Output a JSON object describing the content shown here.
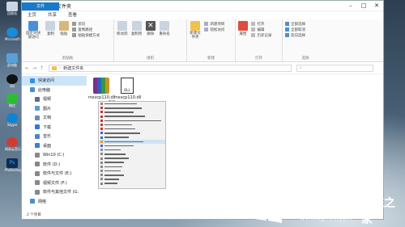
{
  "window": {
    "title": "新建文件夹"
  },
  "tabs": [
    "文件",
    "主页",
    "共享",
    "查看"
  ],
  "ribbon": {
    "clipboard": {
      "label": "剪贴板",
      "pin": "固定到快速访问",
      "copy": "复制",
      "paste": "粘贴",
      "cut": "剪切",
      "copy_path": "复制路径",
      "paste_shortcut": "粘贴快捷方式"
    },
    "organize": {
      "label": "组织",
      "move_to": "移动到",
      "copy_to": "复制到",
      "delete": "删除",
      "rename": "重命名"
    },
    "new": {
      "label": "新建",
      "new_folder": "新建文件夹",
      "new_item": "新建项目",
      "easy_access": "轻松访问"
    },
    "open": {
      "label": "打开",
      "properties": "属性",
      "open": "打开",
      "edit": "编辑",
      "history": "历史记录"
    },
    "select": {
      "label": "选择",
      "select_all": "全部选择",
      "select_none": "全部取消",
      "invert": "反向选择"
    }
  },
  "address": {
    "path": "新建文件夹"
  },
  "nav": {
    "items": [
      {
        "label": "快速访问",
        "color": "#3a8ee6"
      },
      {
        "label": "此电脑",
        "color": "#4a90c8"
      },
      {
        "label": "视频",
        "color": "#5a6e90"
      },
      {
        "label": "图片",
        "color": "#5a9cc8"
      },
      {
        "label": "文档",
        "color": "#6a8eb0"
      },
      {
        "label": "下载",
        "color": "#2f7bd6"
      },
      {
        "label": "音乐",
        "color": "#4a86d0"
      },
      {
        "label": "桌面",
        "color": "#3d7fd1"
      },
      {
        "label": "Win10 (C:)",
        "color": "#888888"
      },
      {
        "label": "软件 (D:)",
        "color": "#888888"
      },
      {
        "label": "软件与文件 (E:)",
        "color": "#888888"
      },
      {
        "label": "视频文件 (F:)",
        "color": "#888888"
      },
      {
        "label": "软件与其他文件 (G:",
        "color": "#888888"
      },
      {
        "label": "网络",
        "color": "#4a90c8"
      }
    ]
  },
  "files": [
    {
      "name": "msvcp110.dll",
      "icon": "winrar-archive-icon"
    },
    {
      "name": "msvcp110.dll",
      "icon": "dll-file-icon"
    }
  ],
  "context_menu": {
    "extra": "一键帮"
  },
  "status": {
    "count": "2 个项目"
  },
  "desktop_icons": [
    "回收站",
    "Microsoft Edge",
    "此电脑",
    "QQ",
    "微信",
    "Skype",
    "网易云音乐",
    "Photoshop"
  ],
  "watermark": {
    "brand": "Windows",
    "cn": "系统之家",
    "url": "www.bjjmlv.com"
  },
  "colors": {
    "accent": "#1979ca",
    "selection": "#cce4f7"
  }
}
